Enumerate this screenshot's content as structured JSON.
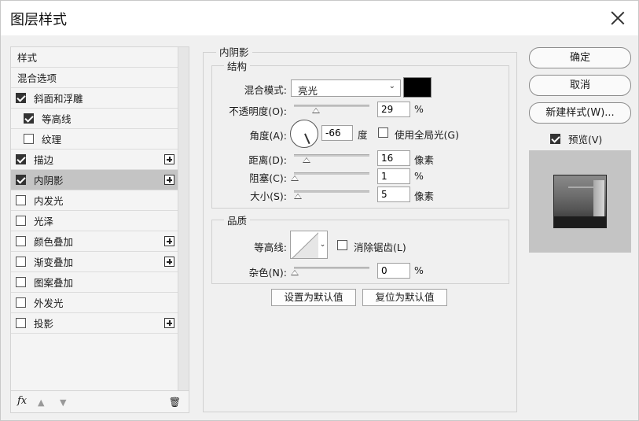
{
  "window": {
    "title": "图层样式",
    "close_icon": "close-icon"
  },
  "style_list": {
    "items": [
      {
        "label": "样式",
        "has_checkbox": false,
        "checked": false,
        "has_plus": false,
        "selected": false
      },
      {
        "label": "混合选项",
        "has_checkbox": false,
        "checked": false,
        "has_plus": false,
        "selected": false
      },
      {
        "label": "斜面和浮雕",
        "has_checkbox": true,
        "checked": true,
        "has_plus": false,
        "selected": false
      },
      {
        "label": "等高线",
        "has_checkbox": true,
        "checked": true,
        "has_plus": false,
        "selected": false,
        "indent": true
      },
      {
        "label": "纹理",
        "has_checkbox": true,
        "checked": false,
        "has_plus": false,
        "selected": false,
        "indent": true
      },
      {
        "label": "描边",
        "has_checkbox": true,
        "checked": true,
        "has_plus": true,
        "selected": false
      },
      {
        "label": "内阴影",
        "has_checkbox": true,
        "checked": true,
        "has_plus": true,
        "selected": true
      },
      {
        "label": "内发光",
        "has_checkbox": true,
        "checked": false,
        "has_plus": false,
        "selected": false
      },
      {
        "label": "光泽",
        "has_checkbox": true,
        "checked": false,
        "has_plus": false,
        "selected": false
      },
      {
        "label": "颜色叠加",
        "has_checkbox": true,
        "checked": false,
        "has_plus": true,
        "selected": false
      },
      {
        "label": "渐变叠加",
        "has_checkbox": true,
        "checked": false,
        "has_plus": true,
        "selected": false
      },
      {
        "label": "图案叠加",
        "has_checkbox": true,
        "checked": false,
        "has_plus": false,
        "selected": false
      },
      {
        "label": "外发光",
        "has_checkbox": true,
        "checked": false,
        "has_plus": false,
        "selected": false
      },
      {
        "label": "投影",
        "has_checkbox": true,
        "checked": false,
        "has_plus": true,
        "selected": false
      }
    ],
    "footer": {
      "fx_label": "fx",
      "up_icon": "arrow-up-icon",
      "down_icon": "arrow-down-icon",
      "trash_icon": "trash-icon"
    }
  },
  "inner_shadow": {
    "title": "内阴影",
    "structure": {
      "title": "结构",
      "blend_mode_label": "混合模式:",
      "blend_mode_value": "亮光",
      "shadow_color": "#000000",
      "opacity_label": "不透明度(O):",
      "opacity_value": "29",
      "opacity_unit": "%",
      "angle_label": "角度(A):",
      "angle_value": "-66",
      "angle_unit": "度",
      "global_light_label": "使用全局光(G)",
      "global_light_checked": false,
      "distance_label": "距离(D):",
      "distance_value": "16",
      "distance_unit": "像素",
      "choke_label": "阻塞(C):",
      "choke_value": "1",
      "choke_unit": "%",
      "size_label": "大小(S):",
      "size_value": "5",
      "size_unit": "像素"
    },
    "quality": {
      "title": "品质",
      "contour_label": "等高线:",
      "anti_alias_label": "消除锯齿(L)",
      "anti_alias_checked": false,
      "noise_label": "杂色(N):",
      "noise_value": "0",
      "noise_unit": "%"
    },
    "set_default_label": "设置为默认值",
    "reset_default_label": "复位为默认值"
  },
  "right_panel": {
    "ok_label": "确定",
    "cancel_label": "取消",
    "new_style_label": "新建样式(W)...",
    "preview_label": "预览(V)",
    "preview_checked": true
  }
}
